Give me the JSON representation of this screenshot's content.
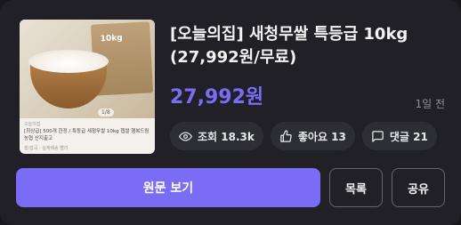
{
  "thumbnail": {
    "bag_label": "10kg",
    "page_indicator": "1/8",
    "seller": "오늘의집",
    "description": "[최상급] 500개 한정 / 특등급 새청무쌀 10kg 햅쌀 행복드림 농협 산지출고",
    "sub": "쌀/잡곡 · 실제배송 빨리"
  },
  "product": {
    "title": "[오늘의집] 새청무쌀 특등급 10kg (27,992원/무료)",
    "price": "27,992원",
    "time": "1일 전"
  },
  "stats": {
    "views_label": "조회 18.3k",
    "likes_label": "좋아요 13",
    "comments_label": "댓글 21"
  },
  "actions": {
    "view_original": "원문 보기",
    "list": "목록",
    "share": "공유"
  },
  "colors": {
    "accent": "#7b6cf6",
    "card_bg": "#202026",
    "chip_bg": "#2d2d34"
  }
}
